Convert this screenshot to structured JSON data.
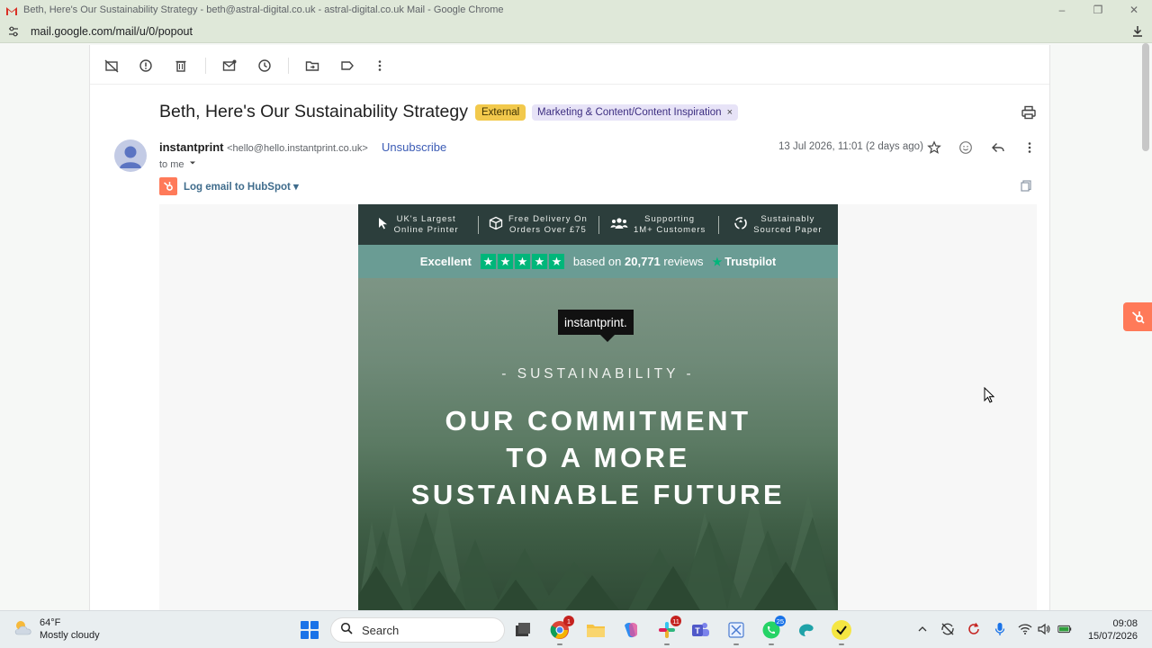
{
  "window": {
    "title": "Beth, Here's Our Sustainability Strategy - beth@astral-digital.co.uk - astral-digital.co.uk Mail - Google Chrome"
  },
  "address_bar": {
    "url": "mail.google.com/mail/u/0/popout"
  },
  "toolbar": {
    "icons": [
      "mark-unread-off-icon",
      "report-spam-icon",
      "delete-icon",
      "mark-email-icon",
      "snooze-icon",
      "move-to-icon",
      "label-icon",
      "more-vert-icon"
    ]
  },
  "email": {
    "subject": "Beth, Here's Our Sustainability Strategy",
    "chip_external": "External",
    "chip_label": "Marketing & Content/Content Inspiration",
    "chip_label_close": "×",
    "sender_name": "instantprint",
    "sender_email": "<hello@hello.instantprint.co.uk>",
    "unsubscribe": "Unsubscribe",
    "to": "to me",
    "date": "13 Jul 2026, 11:01 (2 days ago)",
    "hubspot_link": "Log email to HubSpot"
  },
  "newsletter": {
    "usps": [
      {
        "line1": "UK's Largest",
        "line2": "Online Printer",
        "icon": "cursor-icon"
      },
      {
        "line1": "Free Delivery On",
        "line2": "Orders Over £75",
        "icon": "box-icon"
      },
      {
        "line1": "Supporting",
        "line2": "1M+ Customers",
        "icon": "people-icon"
      },
      {
        "line1": "Sustainably",
        "line2": "Sourced Paper",
        "icon": "recycle-icon"
      }
    ],
    "trustpilot": {
      "rating_word": "Excellent",
      "stars": 5,
      "based_on": "based on",
      "review_count": "20,771",
      "reviews_word": "reviews",
      "brand": "Trustpilot"
    },
    "brand_logo": "instantprint.",
    "eyebrow": "- SUSTAINABILITY -",
    "headline_line1": "OUR COMMITMENT",
    "headline_line2": "TO A MORE",
    "headline_line3": "SUSTAINABLE FUTURE"
  },
  "taskbar": {
    "weather_temp": "64°F",
    "weather_desc": "Mostly cloudy",
    "search_placeholder": "Search",
    "badges": {
      "chrome": "1",
      "slack": "11",
      "whatsapp": "25"
    },
    "time": "09:08",
    "date": "15/07/2026"
  },
  "colors": {
    "chip_external": "#f2c94c",
    "chip_label": "#e7e3f7",
    "hubspot_orange": "#ff7a59",
    "trustpilot_green": "#00b67a",
    "usp_bar": "#2c3e3c",
    "tp_bar": "#6a9c94"
  }
}
